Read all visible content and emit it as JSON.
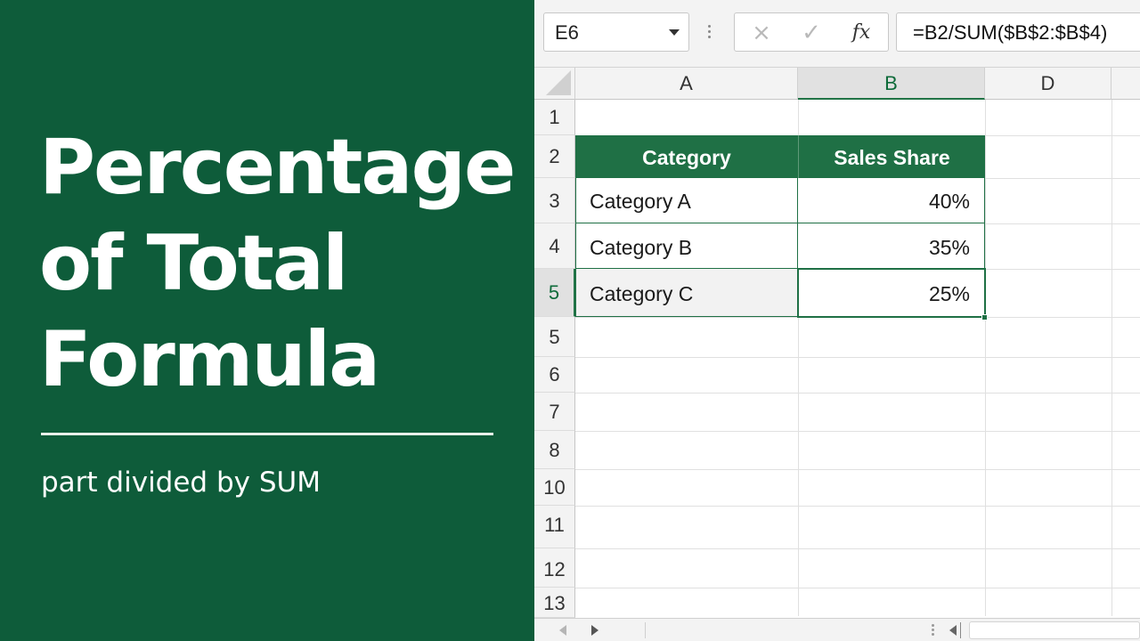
{
  "title_panel": {
    "title_lines": [
      "Percentage",
      "of Total",
      "Formula"
    ],
    "subtitle": "part divided by SUM",
    "background_color": "#0e5c3a"
  },
  "formula_bar": {
    "name_box": "E6",
    "cancel_icon": "×",
    "enter_icon": "✓",
    "fx_label": "fx",
    "formula": "=B2/SUM($B$2:$B$4)"
  },
  "columns": [
    "A",
    "B",
    "D"
  ],
  "rows": [
    "1",
    "2",
    "3",
    "4",
    "5",
    "5",
    "6",
    "7",
    "8",
    "10",
    "11",
    "12",
    "13"
  ],
  "table": {
    "headers": [
      "Category",
      "Sales Share"
    ],
    "rows": [
      {
        "category": "Category A",
        "share": "40%"
      },
      {
        "category": "Category B",
        "share": "35%"
      },
      {
        "category": "Category C",
        "share": "25%"
      }
    ]
  },
  "accent_color": "#1f7045"
}
